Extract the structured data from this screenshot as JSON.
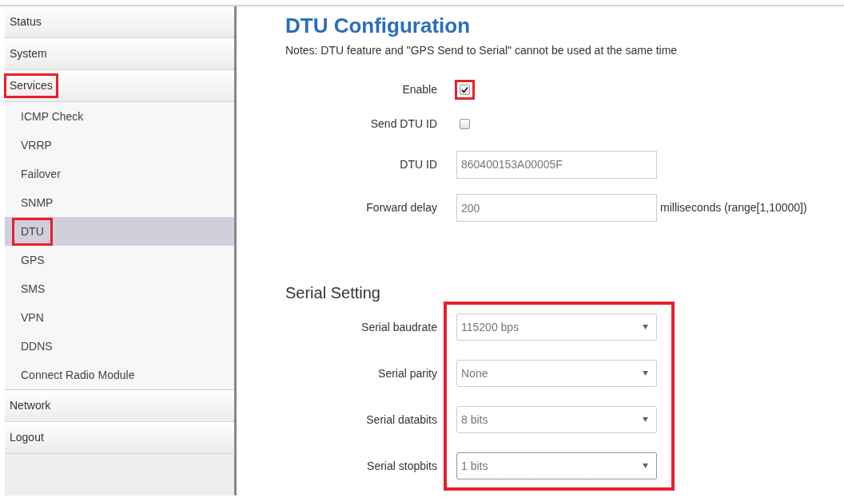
{
  "sidebar": {
    "items": [
      {
        "label": "Status",
        "selected": false,
        "highlighted": false
      },
      {
        "label": "System",
        "selected": false,
        "highlighted": false
      },
      {
        "label": "Services",
        "selected": false,
        "highlighted": true,
        "children": [
          {
            "label": "ICMP Check",
            "selected": false,
            "highlighted": false
          },
          {
            "label": "VRRP",
            "selected": false,
            "highlighted": false
          },
          {
            "label": "Failover",
            "selected": false,
            "highlighted": false
          },
          {
            "label": "SNMP",
            "selected": false,
            "highlighted": false
          },
          {
            "label": "DTU",
            "selected": true,
            "highlighted": true
          },
          {
            "label": "GPS",
            "selected": false,
            "highlighted": false
          },
          {
            "label": "SMS",
            "selected": false,
            "highlighted": false
          },
          {
            "label": "VPN",
            "selected": false,
            "highlighted": false
          },
          {
            "label": "DDNS",
            "selected": false,
            "highlighted": false
          },
          {
            "label": "Connect Radio Module",
            "selected": false,
            "highlighted": false
          }
        ]
      },
      {
        "label": "Network",
        "selected": false,
        "highlighted": false
      },
      {
        "label": "Logout",
        "selected": false,
        "highlighted": false
      }
    ]
  },
  "page": {
    "title": "DTU Configuration",
    "notes": "Notes: DTU feature and \"GPS Send to Serial\" cannot be used at the same time"
  },
  "fields": [
    {
      "kind": "checkbox",
      "label": "Enable",
      "checked": true,
      "highlighted": true
    },
    {
      "kind": "checkbox",
      "label": "Send DTU ID",
      "checked": false,
      "highlighted": false
    },
    {
      "kind": "text",
      "label": "DTU ID",
      "value": "860400153A00005F"
    },
    {
      "kind": "text",
      "label": "Forward delay",
      "value": "200",
      "suffix": "milliseconds (range[1,10000])"
    }
  ],
  "serial": {
    "title": "Serial Setting",
    "highlighted": true,
    "fields": [
      {
        "label": "Serial baudrate",
        "value": "115200 bps",
        "focused": false
      },
      {
        "label": "Serial parity",
        "value": "None",
        "focused": false
      },
      {
        "label": "Serial databits",
        "value": "8 bits",
        "focused": false
      },
      {
        "label": "Serial stopbits",
        "value": "1 bits",
        "focused": true
      }
    ]
  }
}
